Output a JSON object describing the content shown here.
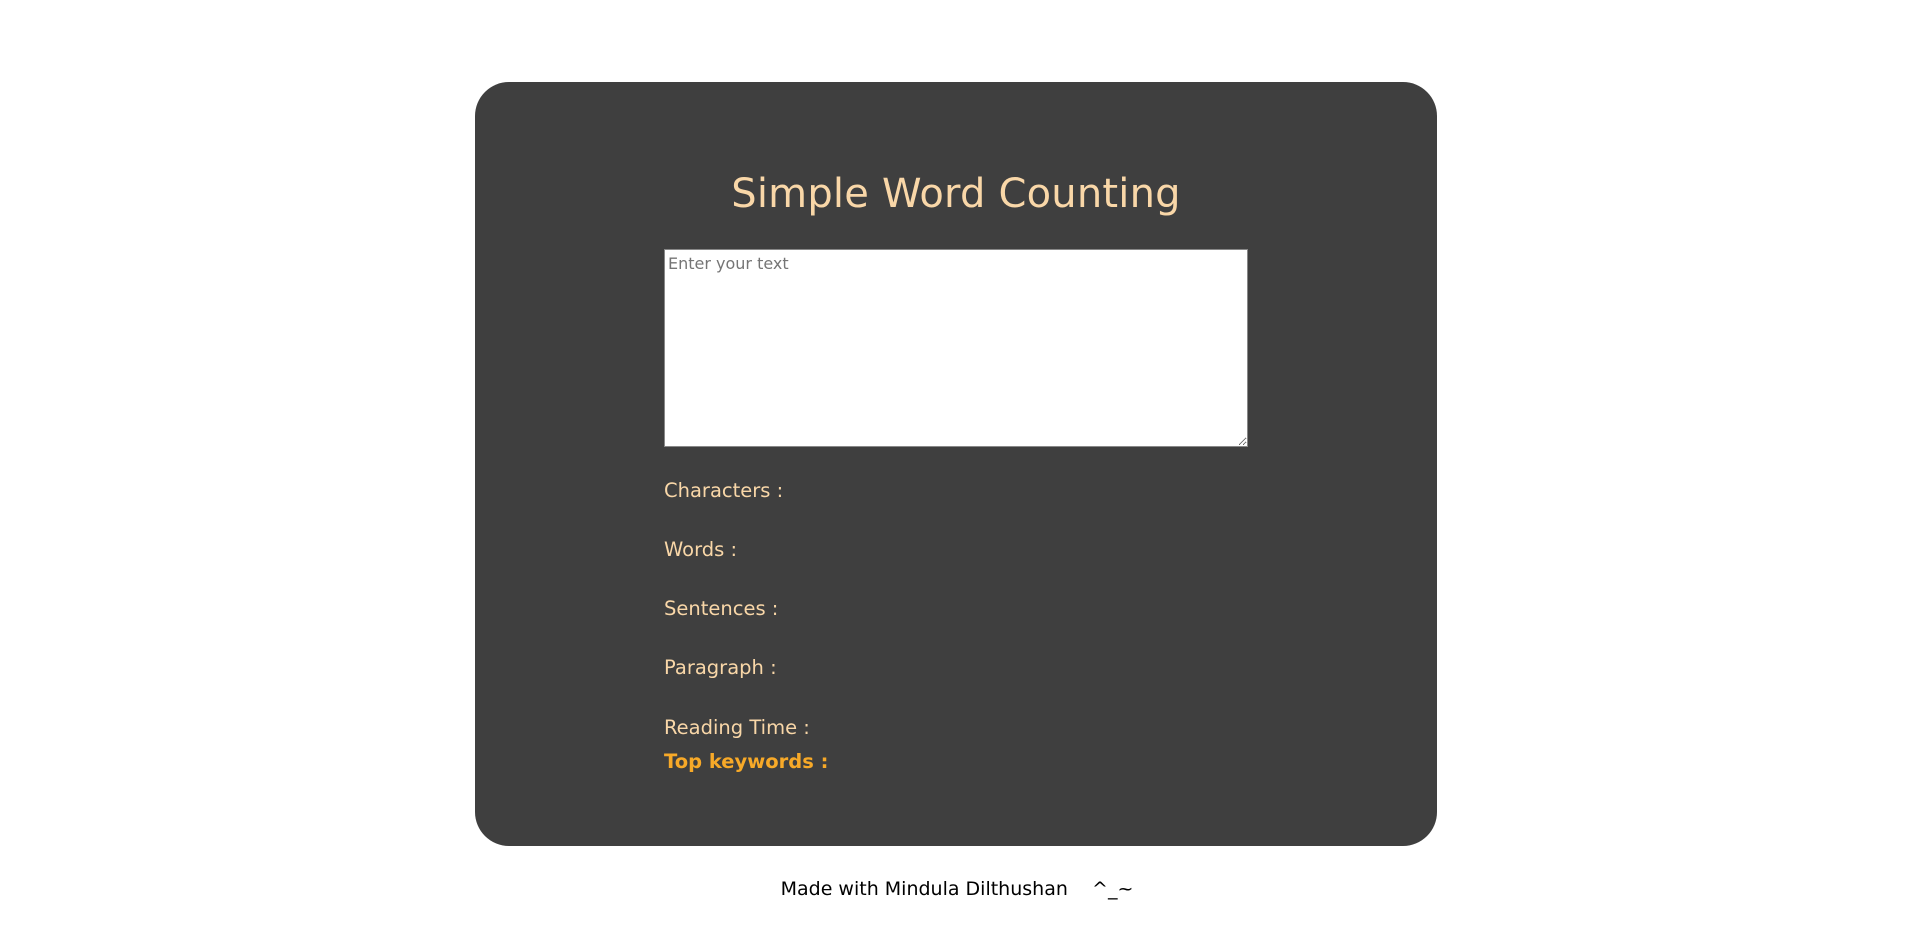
{
  "app": {
    "title": "Simple Word Counting"
  },
  "input": {
    "placeholder": "Enter your text",
    "value": ""
  },
  "stats": {
    "characters_label": "Characters :",
    "characters_value": "",
    "words_label": "Words :",
    "words_value": "",
    "sentences_label": "Sentences :",
    "sentences_value": "",
    "paragraph_label": "Paragraph :",
    "paragraph_value": "",
    "reading_time_label": "Reading Time :",
    "reading_time_value": ""
  },
  "keywords": {
    "label": "Top keywords :"
  },
  "footer": {
    "text": "Made with Mindula Dilthushan    ^_~"
  },
  "colors": {
    "page_background": "#ffffff",
    "card_background": "#3f3f3f",
    "accent_text": "#f9d7a8",
    "keywords_accent": "#f7a928"
  }
}
